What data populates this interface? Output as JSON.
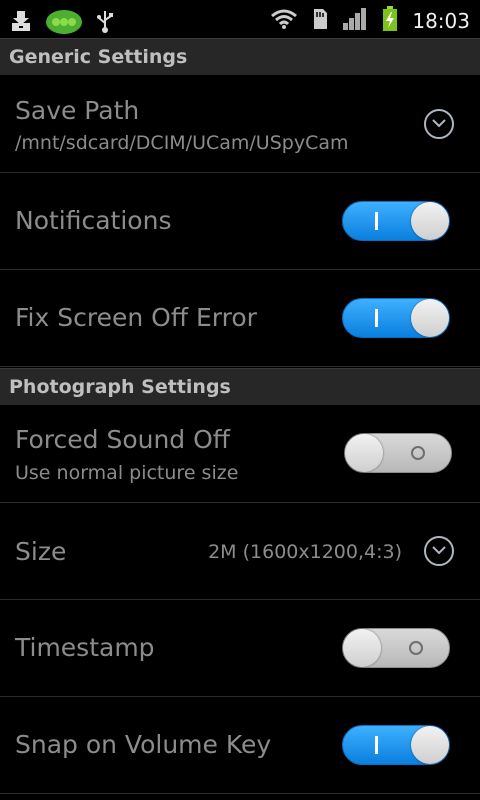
{
  "status_bar": {
    "time": "18:03",
    "icons": [
      "download-icon",
      "app-peapod-icon",
      "usb-icon",
      "wifi-icon",
      "sd-card-icon",
      "signal-icon",
      "battery-charging-icon"
    ]
  },
  "sections": {
    "generic": {
      "title": "Generic Settings"
    },
    "photograph": {
      "title": "Photograph Settings"
    }
  },
  "settings": {
    "save_path": {
      "title": "Save Path",
      "summary": "/mnt/sdcard/DCIM/UCam/USpyCam"
    },
    "notifications": {
      "title": "Notifications",
      "state": "on"
    },
    "fix_screen_off": {
      "title": "Fix Screen Off Error",
      "state": "on"
    },
    "forced_sound_off": {
      "title": "Forced Sound Off",
      "summary": "Use normal picture size",
      "state": "off"
    },
    "size": {
      "title": "Size",
      "value": "2M (1600x1200,4:3)"
    },
    "timestamp": {
      "title": "Timestamp",
      "state": "off"
    },
    "snap_volume": {
      "title": "Snap on Volume Key",
      "state": "on"
    }
  },
  "colors": {
    "background": "#000000",
    "section_header": "#272727",
    "toggle_on": "#1a8fe8",
    "toggle_off": "#c8c8c8",
    "text": "#8c8c8c"
  }
}
